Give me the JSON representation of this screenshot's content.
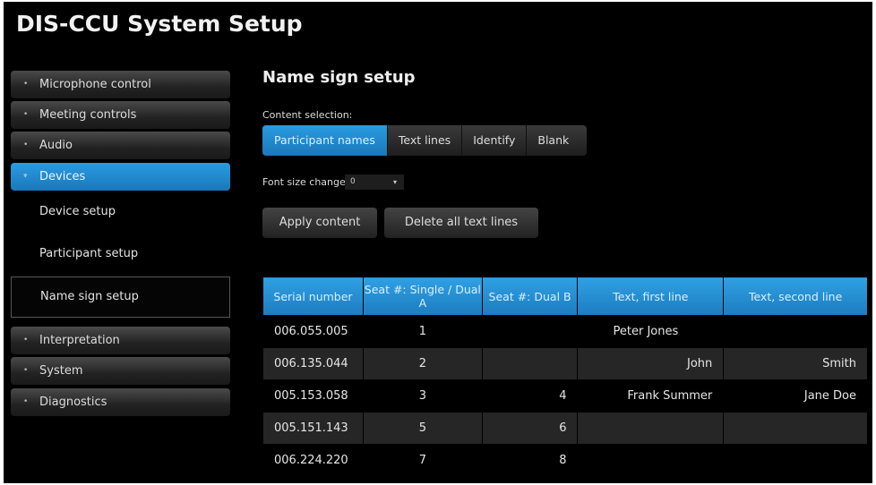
{
  "app_title": "DIS-CCU System Setup",
  "sidebar": {
    "items": [
      {
        "label": "Microphone control",
        "icon": "bullet-icon"
      },
      {
        "label": "Meeting controls",
        "icon": "bullet-icon"
      },
      {
        "label": "Audio",
        "icon": "bullet-icon"
      },
      {
        "label": "Devices",
        "icon": "caret-down-icon"
      },
      {
        "label": "Interpretation",
        "icon": "bullet-icon"
      },
      {
        "label": "System",
        "icon": "bullet-icon"
      },
      {
        "label": "Diagnostics",
        "icon": "bullet-icon"
      }
    ],
    "sub_items": [
      "Device setup",
      "Participant setup",
      "Name sign setup"
    ],
    "bullet": "•",
    "caret": "▾"
  },
  "main": {
    "title": "Name sign setup",
    "content_selection_label": "Content selection:",
    "content_options": [
      "Participant names",
      "Text lines",
      "Identify",
      "Blank"
    ],
    "selected_option": "Participant names",
    "font_size_label": "Font size change:",
    "font_size_value": "0",
    "dropdown_arrow": "▾",
    "apply_label": "Apply content",
    "delete_label": "Delete all text lines"
  },
  "table": {
    "headers": [
      "Serial number",
      "Seat #: Single / Dual A",
      "Seat #: Dual B",
      "Text, first line",
      "Text, second line"
    ],
    "rows": [
      [
        "006.055.005",
        "1",
        "",
        "Peter Jones",
        ""
      ],
      [
        "006.135.044",
        "2",
        "",
        "John",
        "Smith"
      ],
      [
        "005.153.058",
        "3",
        "4",
        "Frank Summer",
        "Jane Doe"
      ],
      [
        "005.151.143",
        "5",
        "6",
        "",
        ""
      ],
      [
        "006.224.220",
        "7",
        "8",
        "",
        ""
      ]
    ]
  },
  "colors": {
    "accent": "#1f87cc",
    "background": "#000000"
  }
}
